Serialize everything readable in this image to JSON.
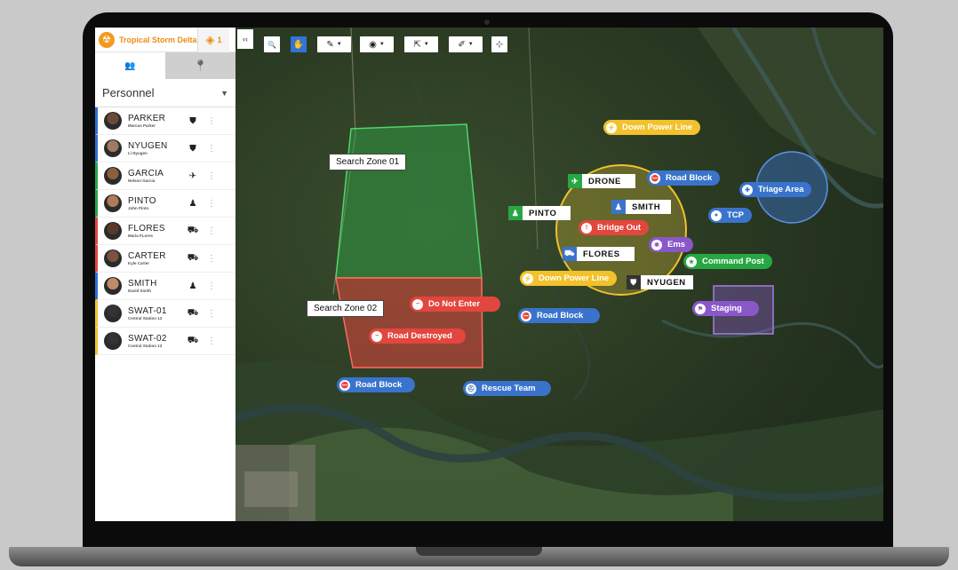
{
  "incident": {
    "name": "Tropical Storm Delta",
    "icon": "hazard-icon",
    "layers_count": "1"
  },
  "sidebar_tabs": [
    {
      "name": "people-icon",
      "glyph": "👥"
    },
    {
      "name": "location-pin-icon",
      "glyph": "📍"
    }
  ],
  "section": {
    "title": "Personnel"
  },
  "personnel": [
    {
      "name": "PARKER",
      "sub": "Marcus Parker",
      "color": "#2f6fd6",
      "role_icon": "police-badge-icon",
      "glyph": "⛊",
      "avatar": "#6b4a3a"
    },
    {
      "name": "NYUGEN",
      "sub": "Li Nyugen",
      "color": "#2f6fd6",
      "role_icon": "police-badge-icon",
      "glyph": "⛊",
      "avatar": "#a07a62"
    },
    {
      "name": "GARCIA",
      "sub": "Nelson Garcia",
      "color": "#27a744",
      "role_icon": "plane-icon",
      "glyph": "✈",
      "avatar": "#8b5e3c"
    },
    {
      "name": "PINTO",
      "sub": "John Pinto",
      "color": "#27a744",
      "role_icon": "person-icon",
      "glyph": "♟",
      "avatar": "#b07a5a"
    },
    {
      "name": "FLORES",
      "sub": "Maria FLores",
      "color": "#e2463e",
      "role_icon": "vehicle-icon",
      "glyph": "⛟",
      "avatar": "#5a3a2a"
    },
    {
      "name": "CARTER",
      "sub": "Kyle Carter",
      "color": "#e2463e",
      "role_icon": "vehicle-icon",
      "glyph": "⛟",
      "avatar": "#7a5240"
    },
    {
      "name": "SMITH",
      "sub": "David Smith",
      "color": "#2f6fd6",
      "role_icon": "person-icon",
      "glyph": "♟",
      "avatar": "#c08a6a"
    },
    {
      "name": "SWAT-01",
      "sub": "Central Station 13",
      "color": "#f2c12b",
      "role_icon": "swat-vehicle-icon",
      "glyph": "⛟",
      "avatar": "#333333"
    },
    {
      "name": "SWAT-02",
      "sub": "Central Station 13",
      "color": "#f2c12b",
      "role_icon": "swat-vehicle-icon",
      "glyph": "⛟",
      "avatar": "#333333"
    }
  ],
  "toolbar": [
    {
      "name": "collapse-button",
      "glyph": "‹‹"
    },
    {
      "name": "search-tool-button",
      "glyph": "🔍"
    },
    {
      "name": "pan-tool-button",
      "glyph": "✋"
    },
    {
      "name": "draw-tool-button",
      "glyph": "✎"
    },
    {
      "name": "marker-tool-button",
      "glyph": "◉"
    },
    {
      "name": "share-tool-button",
      "glyph": "⇱"
    },
    {
      "name": "edit-tool-button",
      "glyph": "✐"
    },
    {
      "name": "measure-tool-button",
      "glyph": "⊹"
    }
  ],
  "map_labels": [
    {
      "name": "down-power-line-label",
      "text": "Down Power Line",
      "kind": "l-yellow",
      "glyph": "⚡"
    },
    {
      "name": "road-block-label",
      "text": "Road Block",
      "kind": "l-blue",
      "glyph": "⛔"
    },
    {
      "name": "triage-area-label",
      "text": "Triage Area",
      "kind": "l-blue",
      "glyph": "✚"
    },
    {
      "name": "tcp-label",
      "text": "TCP",
      "kind": "l-blue",
      "glyph": "●"
    },
    {
      "name": "bridge-out-label",
      "text": "Bridge Out",
      "kind": "l-red",
      "glyph": "!"
    },
    {
      "name": "ems-label",
      "text": "Ems",
      "kind": "l-purple",
      "glyph": "✱"
    },
    {
      "name": "command-post-label",
      "text": "Command Post",
      "kind": "l-green",
      "glyph": "★"
    },
    {
      "name": "down-power-line-label-2",
      "text": "Down Power Line",
      "kind": "l-yellow",
      "glyph": "⚡"
    },
    {
      "name": "do-not-enter-label",
      "text": "Do Not Enter",
      "kind": "l-red",
      "glyph": "−"
    },
    {
      "name": "road-block-label-2",
      "text": "Road Block",
      "kind": "l-blue",
      "glyph": "⛔"
    },
    {
      "name": "staging-label",
      "text": "Staging",
      "kind": "l-purple",
      "glyph": "⚑"
    },
    {
      "name": "road-destroyed-label",
      "text": "Road Destroyed",
      "kind": "l-red",
      "glyph": "−"
    },
    {
      "name": "road-block-label-3",
      "text": "Road Block",
      "kind": "l-blue",
      "glyph": "⛔"
    },
    {
      "name": "rescue-team-label",
      "text": "Rescue Team",
      "kind": "l-blue",
      "glyph": "⛑"
    }
  ],
  "unit_tags": [
    {
      "name": "drone-tag",
      "text": "DRONE",
      "color": "#27a744",
      "glyph": "✈"
    },
    {
      "name": "pinto-tag",
      "text": "PINTO",
      "color": "#27a744",
      "glyph": "♟"
    },
    {
      "name": "smith-tag",
      "text": "SMITH",
      "color": "#3a73cc",
      "glyph": "♟"
    },
    {
      "name": "flores-tag",
      "text": "FLORES",
      "color": "#3a73cc",
      "glyph": "⛟"
    },
    {
      "name": "nyugen-tag",
      "text": "NYUGEN",
      "color": "#333333",
      "glyph": "⛊"
    }
  ],
  "zones": [
    {
      "name": "search-zone-01-label",
      "text": "Search Zone 01"
    },
    {
      "name": "search-zone-02-label",
      "text": "Search Zone 02"
    }
  ]
}
